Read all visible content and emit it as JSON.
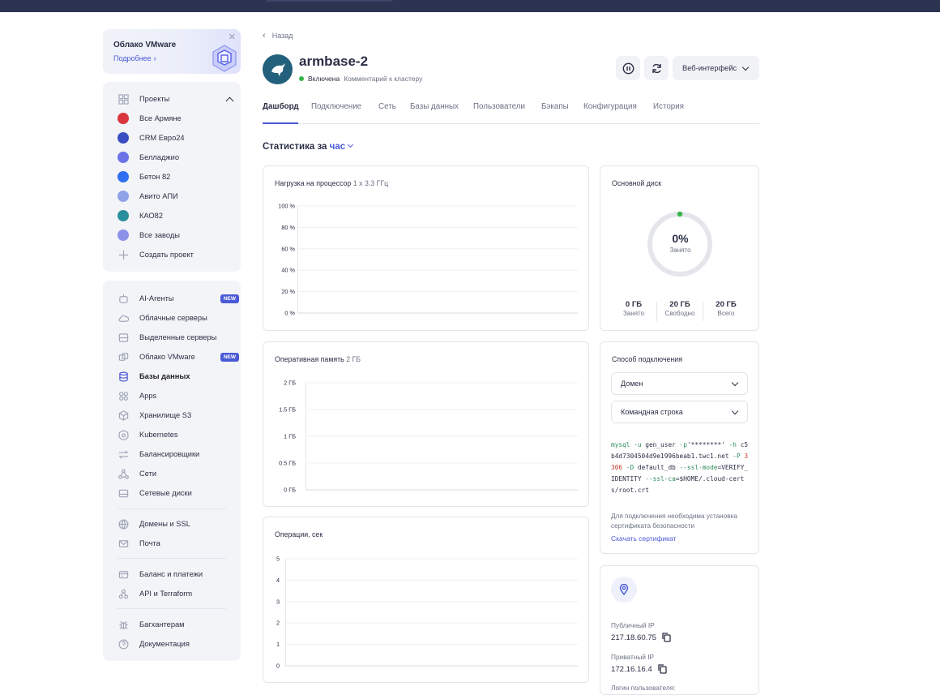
{
  "promo": {
    "title": "Облако VMware",
    "link": "Подробнее"
  },
  "projects": {
    "header": "Проекты",
    "items": [
      {
        "label": "Все Армяне",
        "color": "#d9363e"
      },
      {
        "label": "CRM Евро24",
        "color": "#3a4ec2"
      },
      {
        "label": "Белладжио",
        "color": "#6b73e6"
      },
      {
        "label": "Бетон 82",
        "color": "#2f6ef0"
      },
      {
        "label": "Авито АПИ",
        "color": "#8fa2e8"
      },
      {
        "label": "КАО82",
        "color": "#2a8f9c"
      },
      {
        "label": "Все заводы",
        "color": "#8b93e8"
      }
    ],
    "create": "Создать проект"
  },
  "services": {
    "items": [
      {
        "label": "AI-Агенты",
        "icon": "robot-icon",
        "badge": "NEW"
      },
      {
        "label": "Облачные серверы",
        "icon": "cloud-icon"
      },
      {
        "label": "Выделенные серверы",
        "icon": "server-icon"
      },
      {
        "label": "Облако VMware",
        "icon": "vmware-icon",
        "badge": "NEW"
      },
      {
        "label": "Базы данных",
        "icon": "database-icon",
        "active": true
      },
      {
        "label": "Apps",
        "icon": "apps-icon"
      },
      {
        "label": "Хранилище S3",
        "icon": "cube-icon"
      },
      {
        "label": "Kubernetes",
        "icon": "kubernetes-icon"
      },
      {
        "label": "Балансировщики",
        "icon": "arrows-icon"
      },
      {
        "label": "Сети",
        "icon": "network-icon"
      },
      {
        "label": "Сетевые диски",
        "icon": "disk-icon"
      },
      {
        "label": "Домены и SSL",
        "icon": "globe-icon"
      },
      {
        "label": "Почта",
        "icon": "mail-icon"
      },
      {
        "label": "Баланс и платежи",
        "icon": "wallet-icon"
      },
      {
        "label": "API и Terraform",
        "icon": "api-icon"
      },
      {
        "label": "Багхантерам",
        "icon": "bug-icon"
      },
      {
        "label": "Документация",
        "icon": "help-icon"
      }
    ]
  },
  "header": {
    "back": "Назад",
    "title": "armbase-2",
    "status": "Включена",
    "comment": "Комментарий к кластеру",
    "web_button": "Веб-интерфейс"
  },
  "tabs": [
    "Дашборд",
    "Подключение",
    "Сеть",
    "Базы данных",
    "Пользователи",
    "Бэкапы",
    "Конфигурация",
    "История"
  ],
  "stats": {
    "label": "Статистика за",
    "period": "час"
  },
  "charts": {
    "cpu": {
      "title": "Нагрузка на процессор",
      "sub": "1 x 3.3 ГГц"
    },
    "ram": {
      "title": "Оперативная память",
      "sub": "2 ГБ"
    },
    "ops": {
      "title": "Операции, сек",
      "sub": ""
    }
  },
  "chart_data": [
    {
      "type": "line",
      "title": "Нагрузка на процессор",
      "yticks": [
        "100 %",
        "80 %",
        "60 %",
        "40 %",
        "20 %",
        "0 %"
      ],
      "ylim": [
        0,
        100
      ],
      "series": []
    },
    {
      "type": "line",
      "title": "Оперативная память",
      "yticks": [
        "2 ГБ",
        "1.5 ГБ",
        "1 ГБ",
        "0.5 ГБ",
        "0 ГБ"
      ],
      "ylim": [
        0,
        2
      ],
      "series": []
    },
    {
      "type": "line",
      "title": "Операции, сек",
      "yticks": [
        "5",
        "4",
        "3",
        "2",
        "1",
        "0"
      ],
      "ylim": [
        0,
        5
      ],
      "series": []
    }
  ],
  "disk": {
    "title": "Основной диск",
    "percent": "0%",
    "percent_label": "Занято",
    "used_fraction": 0,
    "used": "0 ГБ",
    "used_label": "Занято",
    "free": "20 ГБ",
    "free_label": "Свободно",
    "total": "20 ГБ",
    "total_label": "Всего"
  },
  "connection": {
    "title": "Способ подключения",
    "select1": "Домен",
    "select2": "Командная строка",
    "cmd": {
      "bin": "mysql",
      "u_flag": "-u",
      "user": "gen_user",
      "p_flag": "-p",
      "pass": "'********'",
      "h_flag": "-h",
      "host": "c5b4d7304504d9e1996beab1.twc1.net",
      "P_flag": "-P",
      "port": "3306",
      "D_flag": "-D",
      "db": "default_db",
      "ssl_flag": "--ssl-mode",
      "ssl_mode": "VERIFY_IDENTITY",
      "ca_flag": "--ssl-ca",
      "ca": "$HOME/.cloud-certs/root.crt"
    },
    "note": "Для подключения необходима установка сертификата безопасности",
    "download": "Скачать сертификат"
  },
  "network": {
    "public_label": "Публичный IP",
    "public_ip": "217.18.60.75",
    "private_label": "Приватный IP",
    "private_ip": "172.16.16.4",
    "login_label": "Логин пользователя:"
  },
  "colors": {
    "accent": "#4a5ad6",
    "topbar": "#2c3452",
    "status_green": "#38b449",
    "avatar": "#22607b"
  }
}
